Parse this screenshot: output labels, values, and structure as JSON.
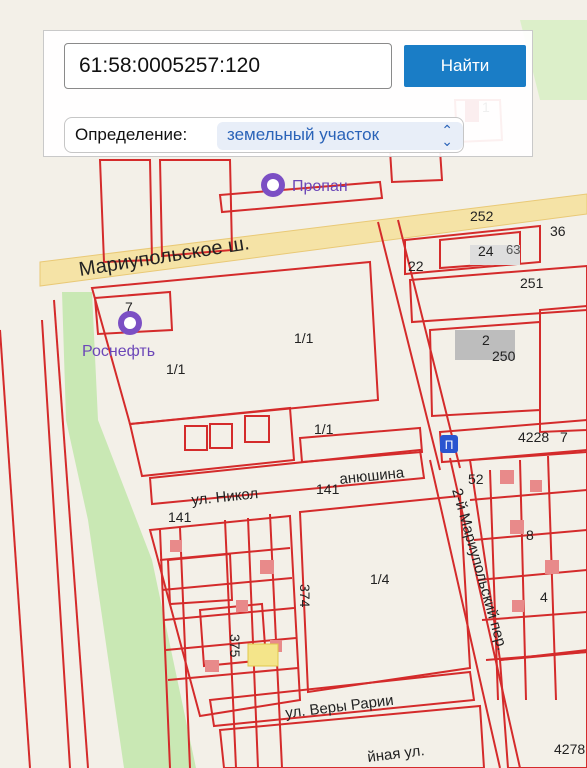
{
  "search": {
    "value": "61:58:0005257:120",
    "button_label": "Найти"
  },
  "definition": {
    "label": "Определение:",
    "selected": "земельный участок"
  },
  "map": {
    "pois": [
      {
        "name": "Пропан",
        "icon": "gas-station-icon"
      },
      {
        "name": "Роснефть",
        "icon": "gas-station-icon"
      }
    ],
    "street_labels": [
      "Мариупольское ш.",
      "ул. Никол",
      "анюшина",
      "ул. Веры Рарии",
      "йная ул.",
      "2-й Мариупольский пер."
    ],
    "parcel_labels": [
      "252",
      "36",
      "24",
      "63",
      "22",
      "251",
      "250",
      "2",
      "1/1",
      "1/1",
      "1/1",
      "7",
      "141",
      "141",
      "374",
      "375",
      "1/4",
      "52",
      "4228",
      "7",
      "4278",
      "8",
      "4",
      "1"
    ],
    "colors": {
      "parcel_border": "#d42b2b",
      "road": "#f5e3a6",
      "poi": "#7b4fc4",
      "button": "#1a7dc6",
      "park": "#c9e8b4",
      "highlight": "#f4e58a"
    }
  }
}
